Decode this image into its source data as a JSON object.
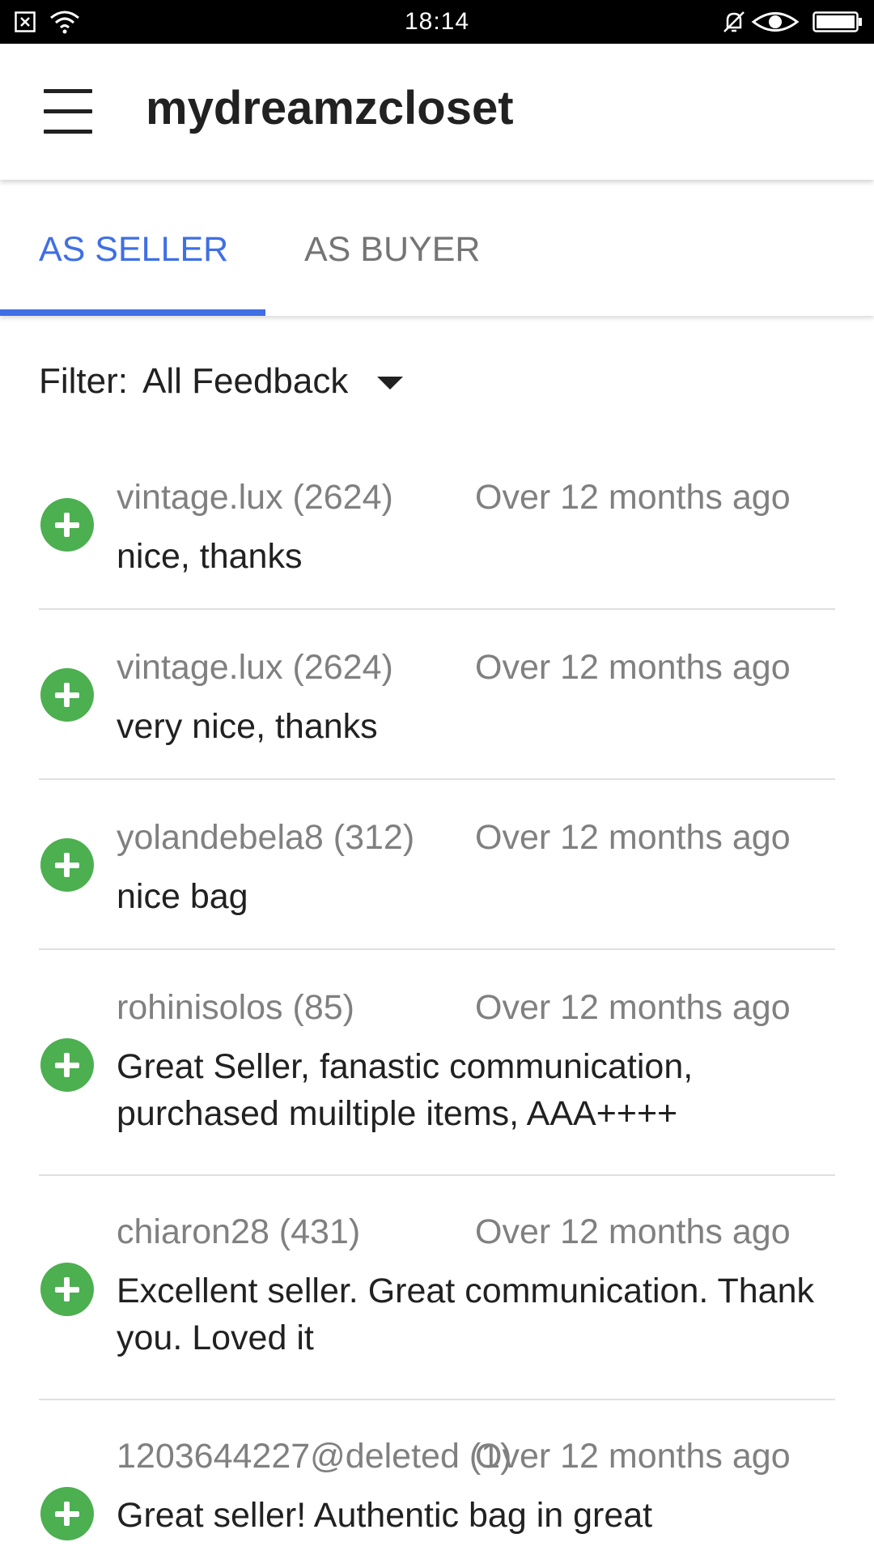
{
  "status_bar": {
    "time": "18:14",
    "icons_left": [
      "close-box-icon",
      "wifi-icon"
    ],
    "icons_right": [
      "bell-off-icon",
      "eye-icon",
      "battery-icon"
    ]
  },
  "app_bar": {
    "title": "mydreamzcloset",
    "menu_icon": "hamburger-menu-icon"
  },
  "tabs": [
    {
      "label": "AS SELLER",
      "active": true
    },
    {
      "label": "AS BUYER",
      "active": false
    }
  ],
  "filter": {
    "label": "Filter:",
    "value": "All Feedback"
  },
  "feedback": [
    {
      "user": "vintage.lux (2624)",
      "time": "Over 12 months ago",
      "comment": "nice, thanks"
    },
    {
      "user": "vintage.lux (2624)",
      "time": "Over 12 months ago",
      "comment": "very nice, thanks"
    },
    {
      "user": "yolandebela8 (312)",
      "time": "Over 12 months ago",
      "comment": "nice bag"
    },
    {
      "user": "rohinisolos (85)",
      "time": "Over 12 months ago",
      "comment": "Great Seller, fanastic communication, purchased muiltiple items, AAA++++"
    },
    {
      "user": "chiaron28 (431)",
      "time": "Over 12 months ago",
      "comment": "Excellent seller. Great communication. Thank you. Loved it"
    },
    {
      "user": "1203644227@deleted (1)",
      "time": "Over 12 months ago",
      "comment": "Great seller! Authentic bag in great"
    }
  ],
  "colors": {
    "accent": "#3f6fe4",
    "positive": "#4caf50",
    "muted_text": "#808080",
    "divider": "#e0e0e0"
  }
}
